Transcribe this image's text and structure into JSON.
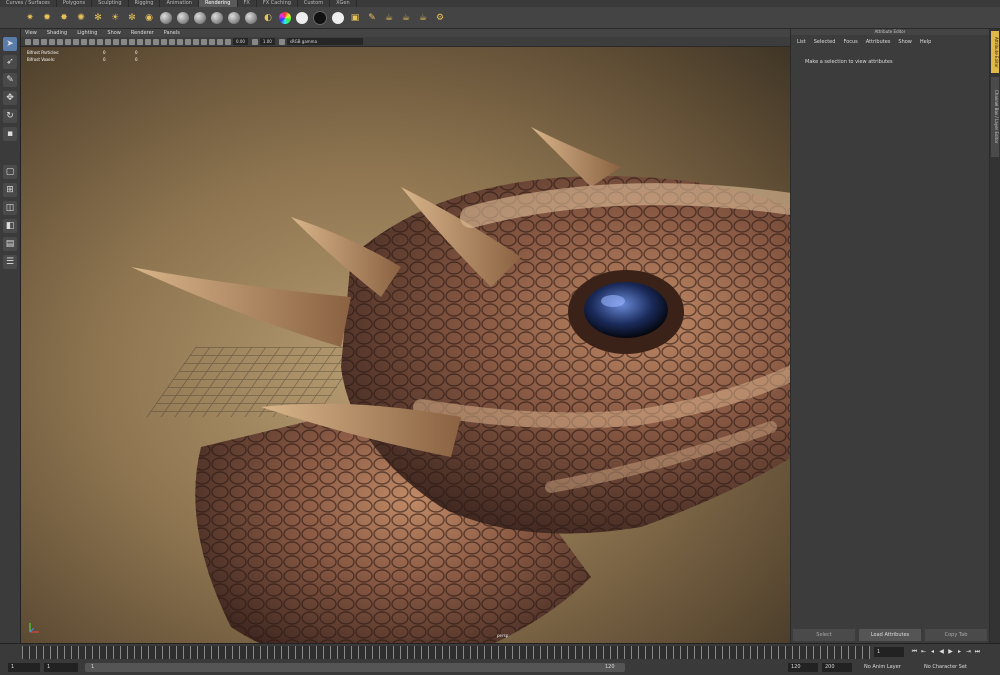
{
  "shelf": {
    "tabs": [
      "Curves / Surfaces",
      "Polygons",
      "Sculpting",
      "Rigging",
      "Animation",
      "Rendering",
      "FX",
      "FX Caching",
      "Custom",
      "XGen"
    ],
    "active_tab": 5
  },
  "panel": {
    "menu": [
      "View",
      "Shading",
      "Lighting",
      "Show",
      "Renderer",
      "Panels"
    ],
    "near_value": "0.00",
    "far_value": "1.00",
    "color_space": "sRGB gamma"
  },
  "hud": {
    "rows": [
      {
        "label": "Bifrost Particles:",
        "a": "0",
        "b": "0"
      },
      {
        "label": "Bifrost Voxels:",
        "a": "0",
        "b": "0"
      }
    ]
  },
  "viewport": {
    "camera": "persp"
  },
  "attribute_editor": {
    "title": "Attribute Editor",
    "menu": [
      "List",
      "Selected",
      "Focus",
      "Attributes",
      "Show",
      "Help"
    ],
    "hint": "Make a selection to view attributes",
    "buttons": [
      "Select",
      "Load Attributes",
      "Copy Tab"
    ]
  },
  "side_tabs": [
    "Attribute Editor",
    "Channel Box / Layer Editor"
  ],
  "timeline": {
    "current_frame": "1",
    "range_start": "1",
    "playback_start": "1",
    "range_bar_start": "1",
    "range_bar_end": "120",
    "playback_end": "120",
    "range_end": "200",
    "anim_layer": "No Anim Layer",
    "char_set": "No Character Set"
  }
}
